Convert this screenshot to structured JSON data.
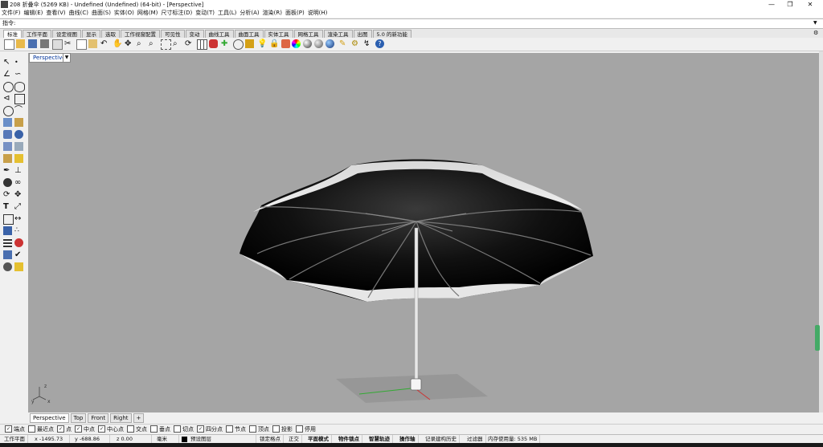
{
  "window": {
    "title": "208 折叠伞 (5269 KB) - Undefined (Undefined) (64-bit) - [Perspective]"
  },
  "menu": [
    "文件(F)",
    "编辑(E)",
    "查看(V)",
    "曲线(C)",
    "曲面(S)",
    "实体(O)",
    "网格(M)",
    "尺寸标注(D)",
    "变动(T)",
    "工具(L)",
    "分析(A)",
    "渲染(R)",
    "面板(P)",
    "说明(H)"
  ],
  "command": {
    "label": "指令:",
    "value": ""
  },
  "toolbar_tabs": [
    "标准",
    "工作平面",
    "设定视图",
    "显示",
    "选取",
    "工作视窗配置",
    "可见性",
    "变动",
    "曲线工具",
    "曲面工具",
    "实体工具",
    "网格工具",
    "渲染工具",
    "出图",
    "5.0 的新功能"
  ],
  "viewport": {
    "label": "Perspective",
    "axes": {
      "x": "x",
      "y": "y",
      "z": "z"
    }
  },
  "view_tabs": [
    "Perspective",
    "Top",
    "Front",
    "Right",
    "+"
  ],
  "osnaps": [
    {
      "label": "端点",
      "checked": true
    },
    {
      "label": "最近点",
      "checked": false
    },
    {
      "label": "点",
      "checked": true
    },
    {
      "label": "中点",
      "checked": true
    },
    {
      "label": "中心点",
      "checked": true
    },
    {
      "label": "交点",
      "checked": false
    },
    {
      "label": "垂点",
      "checked": false
    },
    {
      "label": "切点",
      "checked": false
    },
    {
      "label": "四分点",
      "checked": true
    },
    {
      "label": "节点",
      "checked": false
    },
    {
      "label": "顶点",
      "checked": false
    },
    {
      "label": "投影",
      "checked": false
    },
    {
      "label": "停用",
      "checked": false
    }
  ],
  "status": {
    "cplane": "工作平面",
    "x": "x -1495.73",
    "y": "y -688.86",
    "z": "z 0.00",
    "units": "毫米",
    "layer": "预设图层",
    "lock_grid": "锁定格点",
    "ortho": "正交",
    "planar": "平面模式",
    "osnap": "物件锁点",
    "smarttrack": "智慧轨迹",
    "gumball": "操作轴",
    "history": "记录建构历史",
    "filter": "过滤器",
    "memory": "内存使用量: 535 MB"
  },
  "colors": {
    "viewport_bg": "#a5a5a5",
    "accent": "#0078d7"
  }
}
